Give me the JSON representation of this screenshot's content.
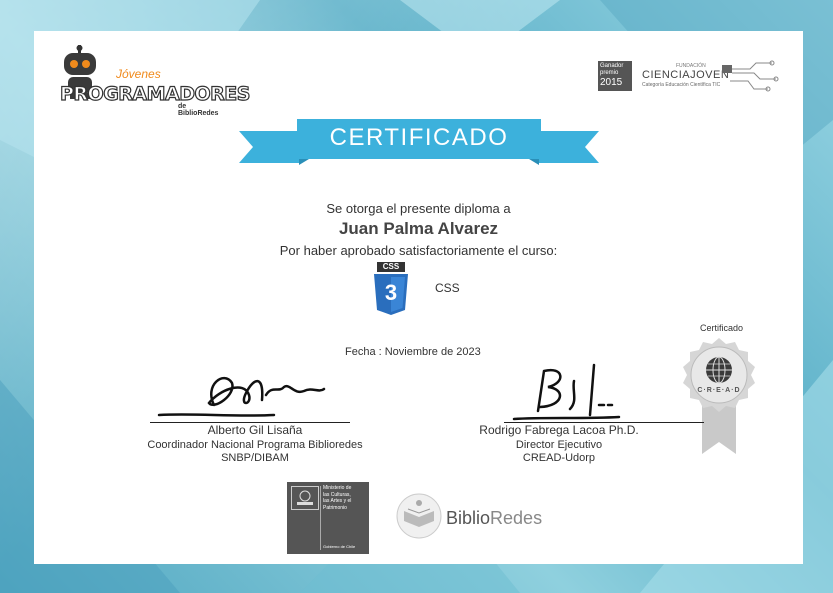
{
  "brand_left": {
    "top": "Jóvenes",
    "main": "PROGRAMADORES",
    "sub": "de BiblioRedes"
  },
  "brand_right": {
    "award_line1": "Ganador",
    "award_line2": "premio",
    "award_year": "2015",
    "name": "CIENCIAJOVEN",
    "caption": "Categoría Educación Científica TIC",
    "tiny": "FUNDACIÓN"
  },
  "ribbon": {
    "title": "CERTIFICADO"
  },
  "body": {
    "line1": "Se otorga el presente diploma a",
    "recipient": "Juan Palma Alvarez",
    "line2": "Por haber aprobado satisfactoriamente el curso:",
    "course_badge": "CSS",
    "course_badge_number": "3",
    "course": "CSS",
    "date": "Fecha : Noviembre de 2023"
  },
  "seal": {
    "label": "Certificado",
    "text": "C·R·E·A·D"
  },
  "signer_left": {
    "name": "Alberto Gil Lisaña",
    "role": "Coordinador Nacional Programa Biblioredes",
    "org": "SNBP/DIBAM"
  },
  "signer_right": {
    "name": "Rodrigo Fabrega Lacoa Ph.D.",
    "role": "Director Ejecutivo",
    "org": "CREAD-Udorp"
  },
  "ministry": {
    "line1": "Ministerio de",
    "line2": "las Culturas,",
    "line3": "las Artes y el",
    "line4": "Patrimonio",
    "footer": "Gobierno de Chile"
  },
  "biblioredes": {
    "part1": "Biblio",
    "part2": "Redes"
  },
  "colors": {
    "ribbon": "#3cb1dc",
    "ribbon_dark": "#2a8fb8",
    "css_blue": "#2a6ebd",
    "brand_orange": "#f08a1c"
  }
}
